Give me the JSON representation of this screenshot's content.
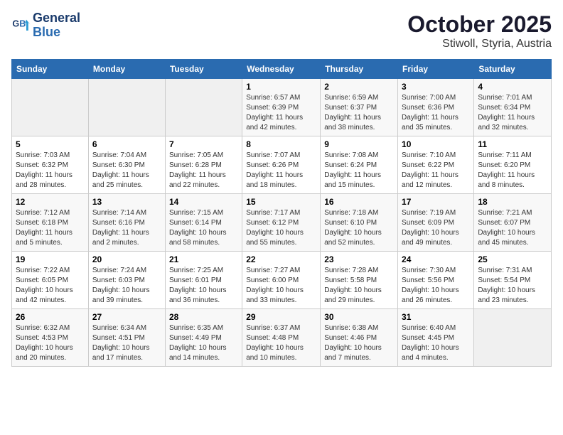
{
  "header": {
    "logo_line1": "General",
    "logo_line2": "Blue",
    "title": "October 2025",
    "subtitle": "Stiwoll, Styria, Austria"
  },
  "weekdays": [
    "Sunday",
    "Monday",
    "Tuesday",
    "Wednesday",
    "Thursday",
    "Friday",
    "Saturday"
  ],
  "weeks": [
    [
      {
        "day": "",
        "info": ""
      },
      {
        "day": "",
        "info": ""
      },
      {
        "day": "",
        "info": ""
      },
      {
        "day": "1",
        "info": "Sunrise: 6:57 AM\nSunset: 6:39 PM\nDaylight: 11 hours and 42 minutes."
      },
      {
        "day": "2",
        "info": "Sunrise: 6:59 AM\nSunset: 6:37 PM\nDaylight: 11 hours and 38 minutes."
      },
      {
        "day": "3",
        "info": "Sunrise: 7:00 AM\nSunset: 6:36 PM\nDaylight: 11 hours and 35 minutes."
      },
      {
        "day": "4",
        "info": "Sunrise: 7:01 AM\nSunset: 6:34 PM\nDaylight: 11 hours and 32 minutes."
      }
    ],
    [
      {
        "day": "5",
        "info": "Sunrise: 7:03 AM\nSunset: 6:32 PM\nDaylight: 11 hours and 28 minutes."
      },
      {
        "day": "6",
        "info": "Sunrise: 7:04 AM\nSunset: 6:30 PM\nDaylight: 11 hours and 25 minutes."
      },
      {
        "day": "7",
        "info": "Sunrise: 7:05 AM\nSunset: 6:28 PM\nDaylight: 11 hours and 22 minutes."
      },
      {
        "day": "8",
        "info": "Sunrise: 7:07 AM\nSunset: 6:26 PM\nDaylight: 11 hours and 18 minutes."
      },
      {
        "day": "9",
        "info": "Sunrise: 7:08 AM\nSunset: 6:24 PM\nDaylight: 11 hours and 15 minutes."
      },
      {
        "day": "10",
        "info": "Sunrise: 7:10 AM\nSunset: 6:22 PM\nDaylight: 11 hours and 12 minutes."
      },
      {
        "day": "11",
        "info": "Sunrise: 7:11 AM\nSunset: 6:20 PM\nDaylight: 11 hours and 8 minutes."
      }
    ],
    [
      {
        "day": "12",
        "info": "Sunrise: 7:12 AM\nSunset: 6:18 PM\nDaylight: 11 hours and 5 minutes."
      },
      {
        "day": "13",
        "info": "Sunrise: 7:14 AM\nSunset: 6:16 PM\nDaylight: 11 hours and 2 minutes."
      },
      {
        "day": "14",
        "info": "Sunrise: 7:15 AM\nSunset: 6:14 PM\nDaylight: 10 hours and 58 minutes."
      },
      {
        "day": "15",
        "info": "Sunrise: 7:17 AM\nSunset: 6:12 PM\nDaylight: 10 hours and 55 minutes."
      },
      {
        "day": "16",
        "info": "Sunrise: 7:18 AM\nSunset: 6:10 PM\nDaylight: 10 hours and 52 minutes."
      },
      {
        "day": "17",
        "info": "Sunrise: 7:19 AM\nSunset: 6:09 PM\nDaylight: 10 hours and 49 minutes."
      },
      {
        "day": "18",
        "info": "Sunrise: 7:21 AM\nSunset: 6:07 PM\nDaylight: 10 hours and 45 minutes."
      }
    ],
    [
      {
        "day": "19",
        "info": "Sunrise: 7:22 AM\nSunset: 6:05 PM\nDaylight: 10 hours and 42 minutes."
      },
      {
        "day": "20",
        "info": "Sunrise: 7:24 AM\nSunset: 6:03 PM\nDaylight: 10 hours and 39 minutes."
      },
      {
        "day": "21",
        "info": "Sunrise: 7:25 AM\nSunset: 6:01 PM\nDaylight: 10 hours and 36 minutes."
      },
      {
        "day": "22",
        "info": "Sunrise: 7:27 AM\nSunset: 6:00 PM\nDaylight: 10 hours and 33 minutes."
      },
      {
        "day": "23",
        "info": "Sunrise: 7:28 AM\nSunset: 5:58 PM\nDaylight: 10 hours and 29 minutes."
      },
      {
        "day": "24",
        "info": "Sunrise: 7:30 AM\nSunset: 5:56 PM\nDaylight: 10 hours and 26 minutes."
      },
      {
        "day": "25",
        "info": "Sunrise: 7:31 AM\nSunset: 5:54 PM\nDaylight: 10 hours and 23 minutes."
      }
    ],
    [
      {
        "day": "26",
        "info": "Sunrise: 6:32 AM\nSunset: 4:53 PM\nDaylight: 10 hours and 20 minutes."
      },
      {
        "day": "27",
        "info": "Sunrise: 6:34 AM\nSunset: 4:51 PM\nDaylight: 10 hours and 17 minutes."
      },
      {
        "day": "28",
        "info": "Sunrise: 6:35 AM\nSunset: 4:49 PM\nDaylight: 10 hours and 14 minutes."
      },
      {
        "day": "29",
        "info": "Sunrise: 6:37 AM\nSunset: 4:48 PM\nDaylight: 10 hours and 10 minutes."
      },
      {
        "day": "30",
        "info": "Sunrise: 6:38 AM\nSunset: 4:46 PM\nDaylight: 10 hours and 7 minutes."
      },
      {
        "day": "31",
        "info": "Sunrise: 6:40 AM\nSunset: 4:45 PM\nDaylight: 10 hours and 4 minutes."
      },
      {
        "day": "",
        "info": ""
      }
    ]
  ]
}
